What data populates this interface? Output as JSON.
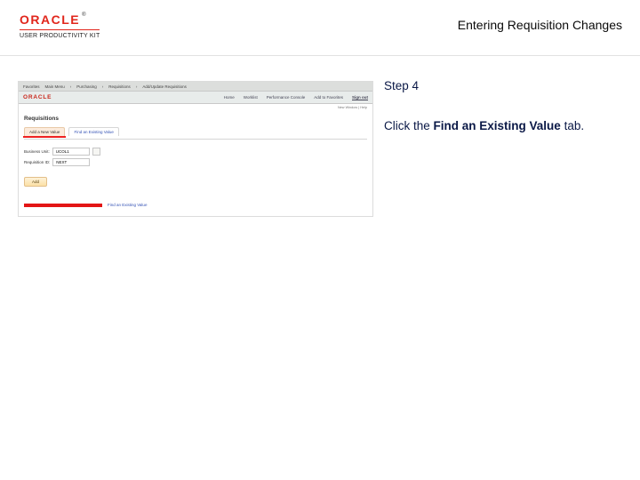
{
  "header": {
    "brand": "ORACLE",
    "brand_sub": "USER PRODUCTIVITY KIT",
    "title": "Entering Requisition Changes"
  },
  "instructions": {
    "step_label": "Step 4",
    "line_prefix": "Click the ",
    "line_bold": "Find an Existing Value",
    "line_suffix": " tab."
  },
  "app": {
    "topbar": [
      "Favorites",
      "Main Menu",
      "Purchasing",
      "Requisitions",
      "Add/Update Requisitions"
    ],
    "logo": "ORACLE",
    "nav": {
      "home": "Home",
      "worklist": "Worklist",
      "perf": "Performance Console",
      "addfav": "Add to Favorites",
      "signout": "Sign out"
    },
    "tz": "New Window | Help",
    "heading": "Requisitions",
    "tabs": {
      "active": "Add a New Value",
      "inactive": "Find an Existing Value"
    },
    "fields": {
      "bu_label": "Business Unit:",
      "bu_value": "UCOL1",
      "req_label": "Requisition ID:",
      "req_value": "NEXT"
    },
    "add_btn": "Add",
    "fev_text": "Find an Existing Value"
  }
}
